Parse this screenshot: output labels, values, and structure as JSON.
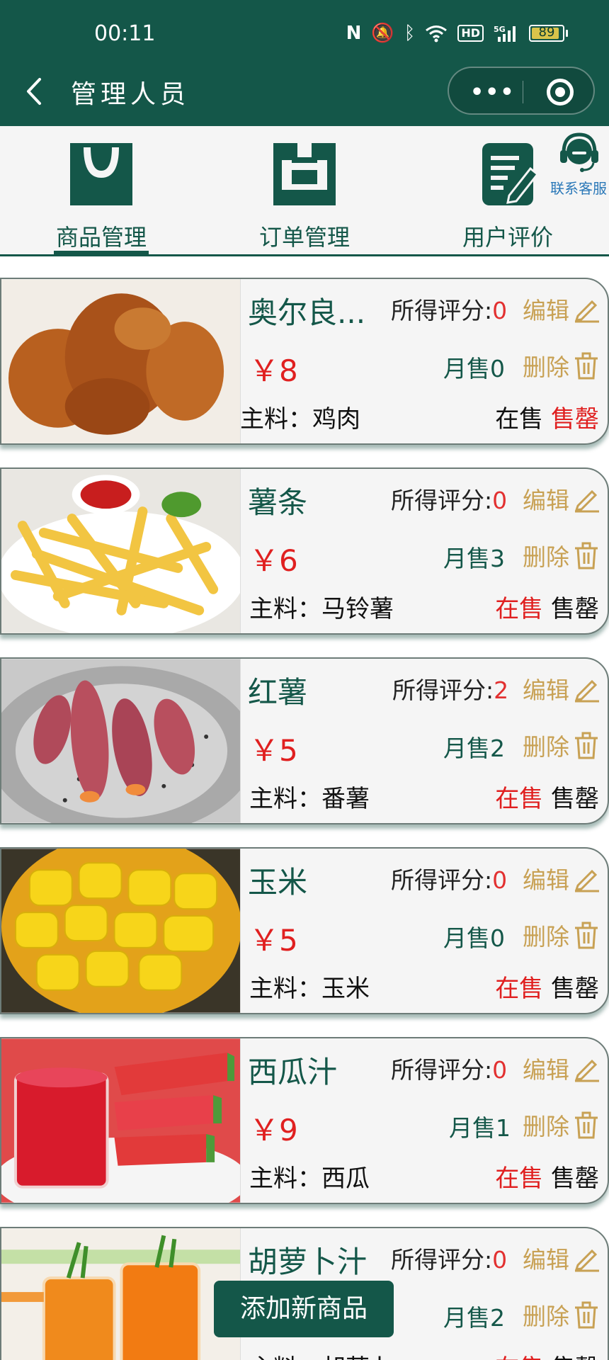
{
  "status_bar": {
    "time": "00:11",
    "battery": "89",
    "hd": "HD",
    "network": "5G"
  },
  "nav": {
    "title": "管理人员",
    "more": "•••"
  },
  "tabs": [
    {
      "label": "商品管理",
      "icon": "shopping-bag-icon",
      "active": true
    },
    {
      "label": "订单管理",
      "icon": "order-list-icon",
      "active": false
    },
    {
      "label": "用户评价",
      "icon": "review-edit-icon",
      "active": false
    }
  ],
  "support": {
    "label": "联系客服",
    "icon": "headset-icon"
  },
  "labels": {
    "score": "所得评分:",
    "edit": "编辑",
    "delete": "删除",
    "sales_prefix": "月售",
    "ingredient_prefix": "主料：",
    "on_sale": "在售",
    "sold_out": "售罄",
    "currency": "￥"
  },
  "products": [
    {
      "name": "奥尔良...",
      "score": "0",
      "price": "8",
      "sales": "0",
      "ingredient": "鸡肉",
      "status": "sold_out",
      "image": "fried-chicken"
    },
    {
      "name": "薯条",
      "score": "0",
      "price": "6",
      "sales": "3",
      "ingredient": "马铃薯",
      "status": "on_sale",
      "image": "french-fries"
    },
    {
      "name": "红薯",
      "score": "2",
      "price": "5",
      "sales": "2",
      "ingredient": "番薯",
      "status": "on_sale",
      "image": "sweet-potato"
    },
    {
      "name": "玉米",
      "score": "0",
      "price": "5",
      "sales": "0",
      "ingredient": "玉米",
      "status": "on_sale",
      "image": "corn"
    },
    {
      "name": "西瓜汁",
      "score": "0",
      "price": "9",
      "sales": "1",
      "ingredient": "西瓜",
      "status": "on_sale",
      "image": "watermelon-juice"
    },
    {
      "name": "胡萝卜汁",
      "score": "0",
      "price": "",
      "sales": "2",
      "ingredient": "胡萝卜",
      "status": "on_sale",
      "image": "carrot-juice"
    }
  ],
  "add_button": {
    "label": "添加新商品"
  },
  "colors": {
    "primary": "#145749",
    "accent_gold": "#c8a154",
    "red": "#e02020",
    "link_blue": "#2a78b8"
  }
}
